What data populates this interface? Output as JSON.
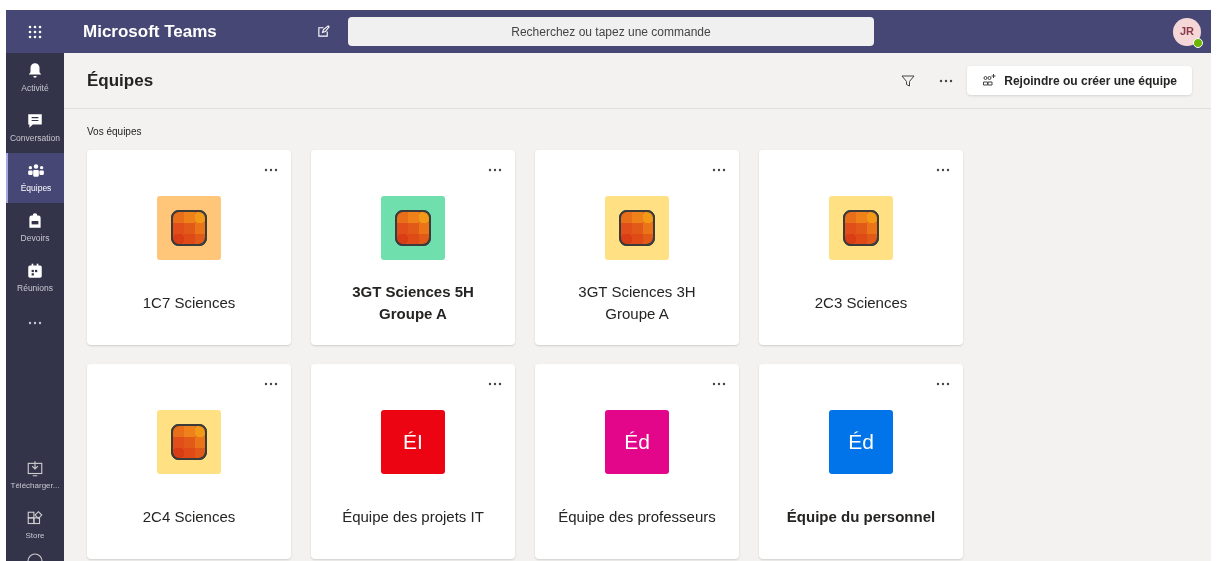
{
  "header": {
    "app_title": "Microsoft Teams",
    "search": {
      "placeholder": "Recherchez ou tapez une commande"
    },
    "avatar": {
      "initials": "JR",
      "online": true
    }
  },
  "sidebar": {
    "items": [
      {
        "kind": "bell",
        "label": "Activité",
        "selected": false
      },
      {
        "kind": "chat",
        "label": "Conversation",
        "selected": false
      },
      {
        "kind": "teams",
        "label": "Équipes",
        "selected": true
      },
      {
        "kind": "bag",
        "label": "Devoirs",
        "selected": false
      },
      {
        "kind": "calendar",
        "label": "Réunions",
        "selected": false
      }
    ],
    "bottom_items": [
      {
        "kind": "download",
        "label": "Télécharger..."
      },
      {
        "kind": "store",
        "label": "Store"
      }
    ]
  },
  "page": {
    "title": "Équipes",
    "join_button": "Rejoindre ou créer une équipe",
    "section_label": "Vos équipes"
  },
  "teams": [
    {
      "name": "1C7 Sciences",
      "kind": "logo",
      "color": "#ffc578",
      "unread": false
    },
    {
      "name": "3GT Sciences 5H Groupe A",
      "kind": "logo",
      "color": "#6fdfad",
      "unread": true
    },
    {
      "name": "3GT Sciences 3H Groupe A",
      "kind": "logo",
      "color": "#ffe082",
      "unread": false
    },
    {
      "name": "2C3 Sciences",
      "kind": "logo",
      "color": "#ffe082",
      "unread": false
    },
    {
      "name": "2C4 Sciences",
      "kind": "logo",
      "color": "#ffe082",
      "unread": false
    },
    {
      "name": "Équipe des projets IT",
      "kind": "initials",
      "initials": "ÉI",
      "color": "#ed0412",
      "unread": false
    },
    {
      "name": "Équipe des professeurs",
      "kind": "initials",
      "initials": "Éd",
      "color": "#e3068a",
      "unread": false
    },
    {
      "name": "Équipe du personnel",
      "kind": "initials",
      "initials": "Éd",
      "color": "#0274e9",
      "unread": true
    }
  ]
}
